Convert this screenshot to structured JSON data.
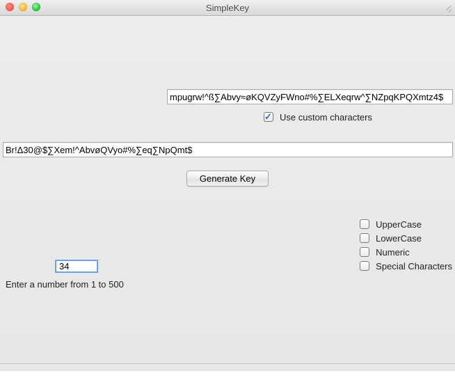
{
  "window": {
    "title": "SimpleKey"
  },
  "customChars": {
    "value": "mpugrw!^ß∑Abvy≈øKQVZyFWno#%∑ELXeqrw^∑NZpqKPQXmtz4$",
    "checkboxLabel": "Use custom characters"
  },
  "output": {
    "value": "Br!Δ30@$∑Xem!^AbvøQVyo#%∑eq∑NpQmt$"
  },
  "actions": {
    "generate": "Generate Key"
  },
  "options": {
    "upper": "UpperCase",
    "lower": "LowerCase",
    "numeric": "Numeric",
    "special": "Special Characters"
  },
  "length": {
    "value": "34",
    "hint": "Enter a number from 1 to 500"
  }
}
